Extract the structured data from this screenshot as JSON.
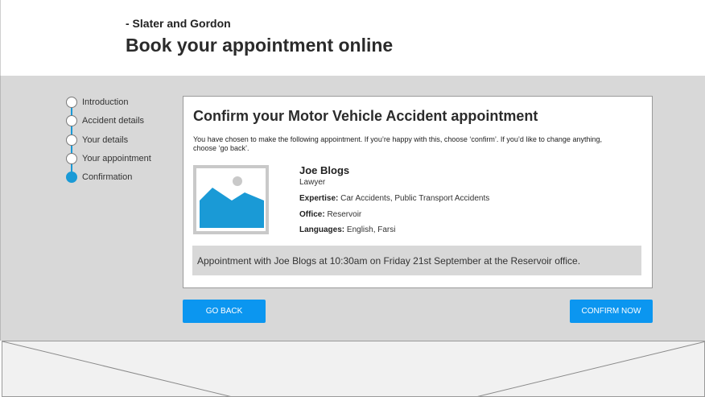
{
  "header": {
    "brand": "- Slater and Gordon",
    "title": "Book your appointment online"
  },
  "steps": [
    {
      "label": "Introduction",
      "state": "done"
    },
    {
      "label": "Accident details",
      "state": "done"
    },
    {
      "label": "Your details",
      "state": "done"
    },
    {
      "label": "Your appointment",
      "state": "done"
    },
    {
      "label": "Confirmation",
      "state": "active"
    }
  ],
  "card": {
    "title": "Confirm your Motor Vehicle Accident appointment",
    "intro": "You have chosen to make the following appointment. If you’re happy with this, choose ‘confirm’. If you’d like to change anything, choose ‘go back’.",
    "photo_icon": "image-placeholder-icon",
    "lawyer": {
      "name": "Joe Blogs",
      "role": "Lawyer",
      "expertise_label": "Expertise:",
      "expertise_value": "Car Accidents, Public Transport Accidents",
      "office_label": "Office:",
      "office_value": "Reservoir",
      "languages_label": "Languages:",
      "languages_value": "English, Farsi"
    },
    "summary": "Appointment with Joe Blogs at 10:30am on Friday 21st September at the Reservoir office."
  },
  "buttons": {
    "back": "GO BACK",
    "confirm": "CONFIRM NOW"
  },
  "footer": {
    "icon": "image-placeholder-icon"
  },
  "colors": {
    "accent": "#0b96f0",
    "progress": "#1a9ad6",
    "panel_bg": "#d8d8d8"
  }
}
